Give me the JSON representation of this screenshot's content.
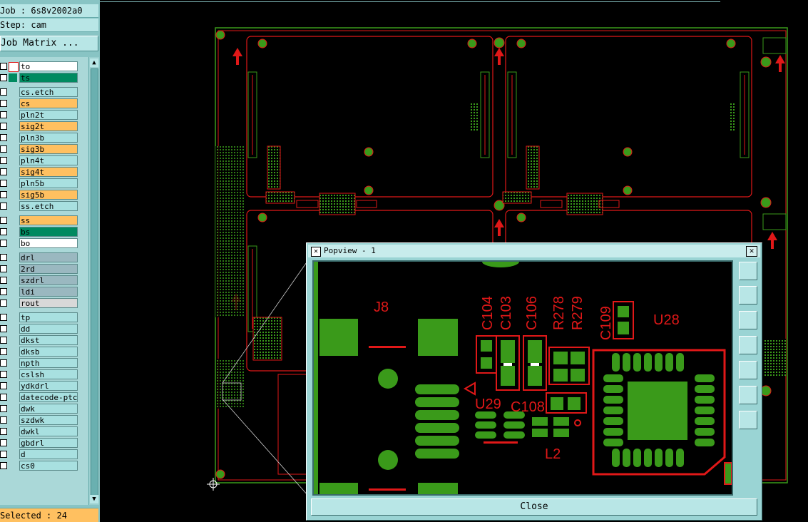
{
  "job_label": "Job : 6s8v2002a0",
  "step_label": "Step: cam",
  "job_matrix_label": "Job Matrix ...",
  "layers": [
    {
      "name": "to",
      "color": "white"
    },
    {
      "name": "ts",
      "color": "green"
    },
    {
      "name": "cs.etch",
      "color": "cyan"
    },
    {
      "name": "cs",
      "color": "orange"
    },
    {
      "name": "pln2t",
      "color": "cyan"
    },
    {
      "name": "sig2t",
      "color": "orange"
    },
    {
      "name": "pln3b",
      "color": "cyan"
    },
    {
      "name": "sig3b",
      "color": "orange"
    },
    {
      "name": "pln4t",
      "color": "cyan"
    },
    {
      "name": "sig4t",
      "color": "orange"
    },
    {
      "name": "pln5b",
      "color": "cyan"
    },
    {
      "name": "sig5b",
      "color": "orange"
    },
    {
      "name": "ss.etch",
      "color": "cyan"
    },
    {
      "name": "ss",
      "color": "orange"
    },
    {
      "name": "bs",
      "color": "green"
    },
    {
      "name": "bo",
      "color": "white"
    },
    {
      "name": "drl",
      "color": "grey"
    },
    {
      "name": "2rd",
      "color": "grey"
    },
    {
      "name": "szdrl",
      "color": "grey"
    },
    {
      "name": "ldi",
      "color": "grey"
    },
    {
      "name": "rout",
      "color": "lgrey"
    },
    {
      "name": "tp",
      "color": "cyan"
    },
    {
      "name": "dd",
      "color": "cyan"
    },
    {
      "name": "dkst",
      "color": "cyan"
    },
    {
      "name": "dksb",
      "color": "cyan"
    },
    {
      "name": "npth",
      "color": "cyan"
    },
    {
      "name": "cslsh",
      "color": "cyan"
    },
    {
      "name": "ydkdrl",
      "color": "cyan"
    },
    {
      "name": "datecode-ptc",
      "color": "cyan"
    },
    {
      "name": "dwk",
      "color": "cyan"
    },
    {
      "name": "szdwk",
      "color": "cyan"
    },
    {
      "name": "dwkl",
      "color": "cyan"
    },
    {
      "name": "gbdrl",
      "color": "cyan"
    },
    {
      "name": "d",
      "color": "cyan"
    },
    {
      "name": "cs0",
      "color": "cyan"
    }
  ],
  "selected_label": "Selected : 24",
  "popview": {
    "title": "Popview - 1",
    "close_label": "Close",
    "component_labels": {
      "j8": "J8",
      "c104": "C104",
      "c103": "C103",
      "c106": "C106",
      "r278": "R278",
      "r279": "R279",
      "c109": "C109",
      "u28": "U28",
      "u29": "U29",
      "c108": "C108",
      "l2": "L2"
    }
  },
  "colors": {
    "trace": "#e01818",
    "pad": "#3a9a1a",
    "panel": "#88c4c4",
    "highlight": "#ffc060"
  }
}
